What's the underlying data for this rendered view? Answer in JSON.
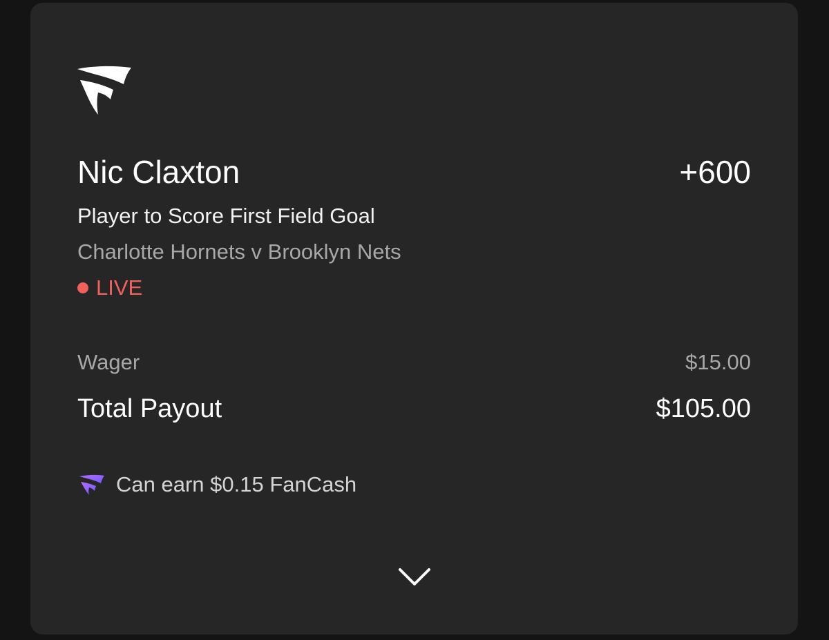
{
  "bet": {
    "player": "Nic Claxton",
    "odds": "+600",
    "market": "Player to Score First Field Goal",
    "event": "Charlotte Hornets v Brooklyn Nets",
    "status": "LIVE"
  },
  "summary": {
    "wager_label": "Wager",
    "wager_value": "$15.00",
    "payout_label": "Total Payout",
    "payout_value": "$105.00"
  },
  "fancash": {
    "text": "Can earn $0.15 FanCash",
    "icon": "fanatics-f-icon"
  },
  "icons": {
    "brand_logo": "fanatics-logo-icon",
    "expand": "chevron-down-icon"
  },
  "colors": {
    "live": "#f0605d",
    "fancash_gradient_start": "#b86cff",
    "fancash_gradient_end": "#6f5bff"
  }
}
